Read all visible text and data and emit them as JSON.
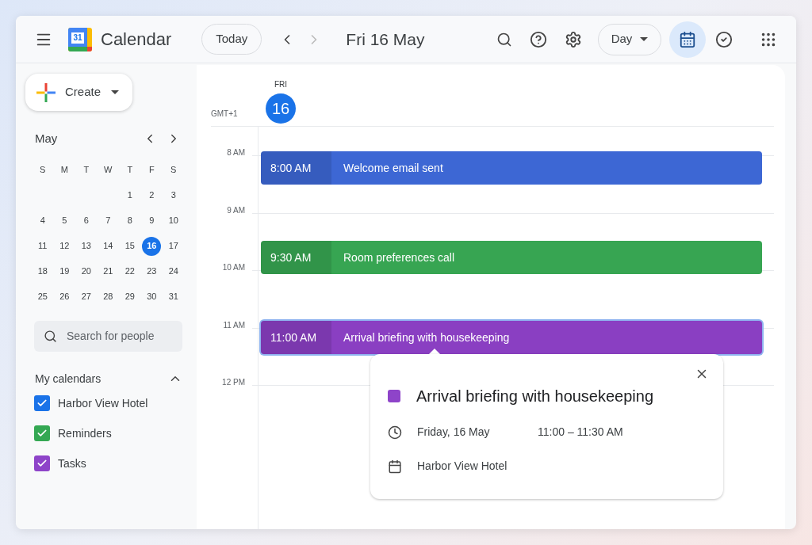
{
  "header": {
    "app_name": "Calendar",
    "logo_text": "31",
    "today": "Today",
    "date_title": "Fri 16 May",
    "view": "Day",
    "mode_toggles": [
      {
        "kind": "calendar",
        "selected": true
      },
      {
        "kind": "tasks",
        "selected": false
      }
    ]
  },
  "sidebar": {
    "create": "Create",
    "mini_calendar": {
      "month": "May",
      "weekdays": [
        "S",
        "M",
        "T",
        "W",
        "T",
        "F",
        "S"
      ],
      "days": [
        {
          "kind": "blank"
        },
        {
          "kind": "blank"
        },
        {
          "kind": "blank"
        },
        {
          "kind": "blank"
        },
        {
          "kind": "day",
          "label": "1",
          "selected": false
        },
        {
          "kind": "day",
          "label": "2",
          "selected": false
        },
        {
          "kind": "day",
          "label": "3",
          "selected": false
        },
        {
          "kind": "day",
          "label": "4",
          "selected": false
        },
        {
          "kind": "day",
          "label": "5",
          "selected": false
        },
        {
          "kind": "day",
          "label": "6",
          "selected": false
        },
        {
          "kind": "day",
          "label": "7",
          "selected": false
        },
        {
          "kind": "day",
          "label": "8",
          "selected": false
        },
        {
          "kind": "day",
          "label": "9",
          "selected": false
        },
        {
          "kind": "day",
          "label": "10",
          "selected": false
        },
        {
          "kind": "day",
          "label": "11",
          "selected": false
        },
        {
          "kind": "day",
          "label": "12",
          "selected": false
        },
        {
          "kind": "day",
          "label": "13",
          "selected": false
        },
        {
          "kind": "day",
          "label": "14",
          "selected": false
        },
        {
          "kind": "day",
          "label": "15",
          "selected": false
        },
        {
          "kind": "day",
          "label": "16",
          "selected": true
        },
        {
          "kind": "day",
          "label": "17",
          "selected": false
        },
        {
          "kind": "day",
          "label": "18",
          "selected": false
        },
        {
          "kind": "day",
          "label": "19",
          "selected": false
        },
        {
          "kind": "day",
          "label": "20",
          "selected": false
        },
        {
          "kind": "day",
          "label": "21",
          "selected": false
        },
        {
          "kind": "day",
          "label": "22",
          "selected": false
        },
        {
          "kind": "day",
          "label": "23",
          "selected": false
        },
        {
          "kind": "day",
          "label": "24",
          "selected": false
        },
        {
          "kind": "day",
          "label": "25",
          "selected": false
        },
        {
          "kind": "day",
          "label": "26",
          "selected": false
        },
        {
          "kind": "day",
          "label": "27",
          "selected": false
        },
        {
          "kind": "day",
          "label": "28",
          "selected": false
        },
        {
          "kind": "day",
          "label": "29",
          "selected": false
        },
        {
          "kind": "day",
          "label": "30",
          "selected": false
        },
        {
          "kind": "day",
          "label": "31",
          "selected": false
        }
      ]
    },
    "search": {
      "placeholder": "Search for people"
    },
    "my_calendars": {
      "title": "My calendars",
      "expanded": true,
      "items": [
        {
          "label": "Harbor View Hotel",
          "checked": true,
          "color": "#1a73e8"
        },
        {
          "label": "Reminders",
          "checked": true,
          "color": "#34a853"
        },
        {
          "label": "Tasks",
          "checked": true,
          "color": "#8e44c9"
        }
      ]
    }
  },
  "day_view": {
    "weekday": "FRI",
    "day": "16",
    "timezone": "GMT+1",
    "hours": [
      "8 AM",
      "9 AM",
      "10 AM",
      "11 AM",
      "12 PM"
    ],
    "events": [
      {
        "time": "8:00 AM",
        "title": "Welcome email sent",
        "color": "#3d67d4",
        "selected": false
      },
      {
        "time": "9:30 AM",
        "title": "Room preferences call",
        "color": "#37a552",
        "selected": false
      },
      {
        "time": "11:00 AM",
        "title": "Arrival briefing with housekeeping",
        "color": "#8a3fc2",
        "selected": true
      }
    ],
    "popover": {
      "title": "Arrival briefing with housekeeping",
      "color": "#8e44c9",
      "date": "Friday, 16 May",
      "time_range": "11:00 – 11:30 AM",
      "calendar": "Harbor View Hotel"
    }
  }
}
